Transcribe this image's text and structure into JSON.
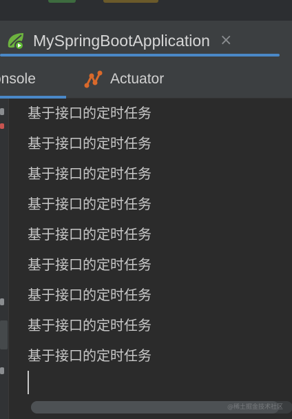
{
  "run_tab": {
    "title": "MySpringBootApplication",
    "close_glyph": "×",
    "icon": "spring-boot-run-icon"
  },
  "tool_tabs": {
    "console_label": "onsole",
    "actuator_label": "Actuator",
    "actuator_icon": "actuator-icon"
  },
  "console": {
    "lines": [
      "基于接口的定时任务",
      "基于接口的定时任务",
      "基于接口的定时任务",
      "基于接口的定时任务",
      "基于接口的定时任务",
      "基于接口的定时任务",
      "基于接口的定时任务",
      "基于接口的定时任务",
      "基于接口的定时任务"
    ]
  },
  "watermark": "@稀土掘金技术社区",
  "colors": {
    "accent": "#4a88c7",
    "spring_green": "#6db33f",
    "actuator_orange": "#d9692b"
  }
}
